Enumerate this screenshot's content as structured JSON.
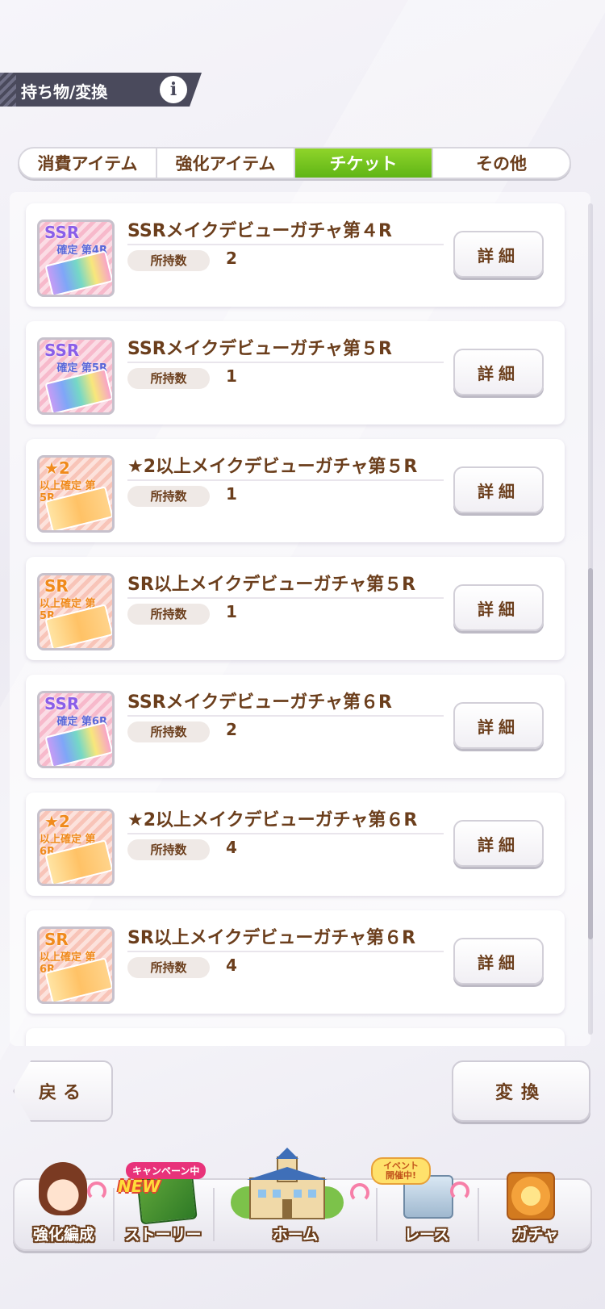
{
  "header": {
    "title": "持ち物/変換",
    "info_label": "i"
  },
  "tabs": [
    {
      "label": "消費アイテム",
      "active": false
    },
    {
      "label": "強化アイテム",
      "active": false
    },
    {
      "label": "チケット",
      "active": true
    },
    {
      "label": "その他",
      "active": false
    }
  ],
  "quantity_label": "所持数",
  "detail_label": "詳細",
  "items": [
    {
      "name": "SSRメイクデビューガチャ第４R",
      "quantity": "2",
      "icon_title": "SSR",
      "icon_sub": "確定 第4R",
      "icon_style": "pink"
    },
    {
      "name": "SSRメイクデビューガチャ第５R",
      "quantity": "1",
      "icon_title": "SSR",
      "icon_sub": "確定 第5R",
      "icon_style": "pink"
    },
    {
      "name": "★2以上メイクデビューガチャ第５R",
      "quantity": "1",
      "icon_title": "★2",
      "icon_sub": "以上確定 第5R",
      "icon_style": "orange"
    },
    {
      "name": "SR以上メイクデビューガチャ第５R",
      "quantity": "1",
      "icon_title": "SR",
      "icon_sub": "以上確定 第5R",
      "icon_style": "orange"
    },
    {
      "name": "SSRメイクデビューガチャ第６R",
      "quantity": "2",
      "icon_title": "SSR",
      "icon_sub": "確定 第6R",
      "icon_style": "pink"
    },
    {
      "name": "★2以上メイクデビューガチャ第６R",
      "quantity": "4",
      "icon_title": "★2",
      "icon_sub": "以上確定 第6R",
      "icon_style": "orange"
    },
    {
      "name": "SR以上メイクデビューガチャ第６R",
      "quantity": "4",
      "icon_title": "SR",
      "icon_sub": "以上確定 第6R",
      "icon_style": "orange"
    }
  ],
  "buttons": {
    "back": "戻る",
    "convert": "変換"
  },
  "bottom_nav": {
    "items": [
      {
        "label": "強化編成"
      },
      {
        "label": "ストーリー",
        "badge": "キャンペーン中",
        "new_badge": "NEW"
      },
      {
        "label": "ホーム"
      },
      {
        "label": "レース",
        "badge": "イベント開催中!"
      },
      {
        "label": "ガチャ"
      }
    ]
  },
  "colors": {
    "text_brown": "#6b3e1c",
    "tab_active": "#6ec41f",
    "header_bg": "#4a4a5c"
  }
}
